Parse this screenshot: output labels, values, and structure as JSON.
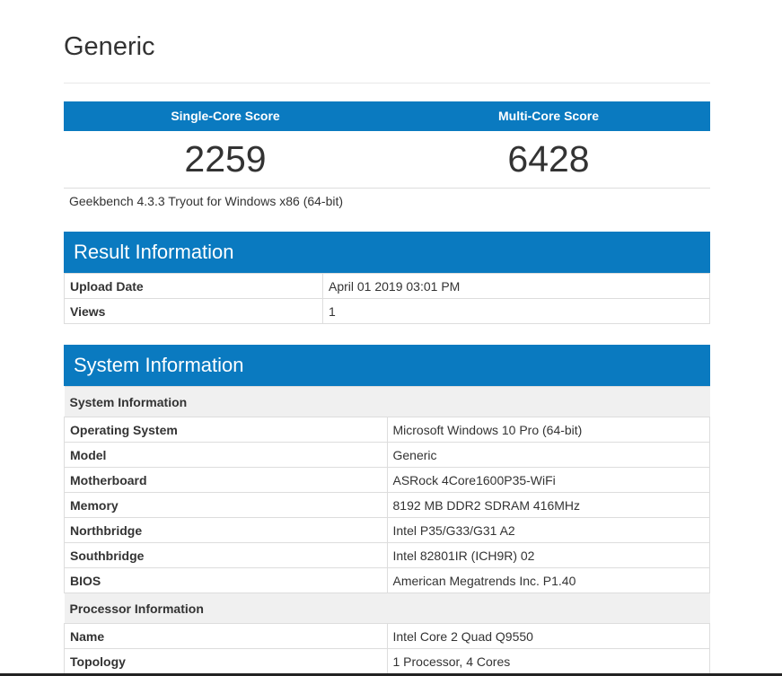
{
  "page": {
    "title": "Generic"
  },
  "scores": {
    "single_core_label": "Single-Core Score",
    "multi_core_label": "Multi-Core Score",
    "single_core_value": "2259",
    "multi_core_value": "6428"
  },
  "version_text": "Geekbench 4.3.3 Tryout for Windows x86 (64-bit)",
  "result_info": {
    "title": "Result Information",
    "rows": [
      {
        "key": "Upload Date",
        "value": "April 01 2019 03:01 PM"
      },
      {
        "key": "Views",
        "value": "1"
      }
    ]
  },
  "system_info": {
    "title": "System Information",
    "subsection_system": "System Information",
    "system_rows": [
      {
        "key": "Operating System",
        "value": "Microsoft Windows 10 Pro (64-bit)"
      },
      {
        "key": "Model",
        "value": "Generic"
      },
      {
        "key": "Motherboard",
        "value": "ASRock 4Core1600P35-WiFi"
      },
      {
        "key": "Memory",
        "value": "8192 MB DDR2 SDRAM 416MHz"
      },
      {
        "key": "Northbridge",
        "value": "Intel P35/G33/G31 A2"
      },
      {
        "key": "Southbridge",
        "value": "Intel 82801IR (ICH9R) 02"
      },
      {
        "key": "BIOS",
        "value": "American Megatrends Inc. P1.40"
      }
    ],
    "subsection_processor": "Processor Information",
    "processor_rows": [
      {
        "key": "Name",
        "value": "Intel Core 2 Quad Q9550"
      },
      {
        "key": "Topology",
        "value": "1 Processor, 4 Cores"
      }
    ]
  },
  "colors": {
    "accent": "#0a7ac0",
    "subheader_bg": "#f0f0f0",
    "border": "#dddddd"
  }
}
